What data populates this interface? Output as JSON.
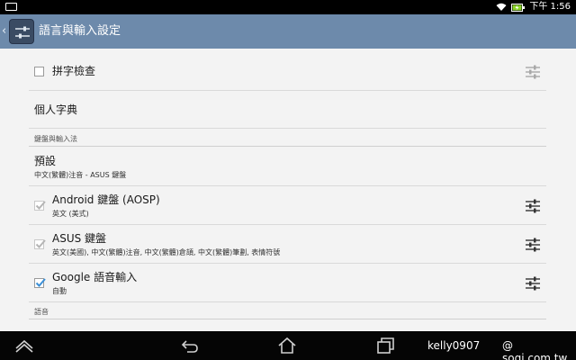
{
  "status_bar": {
    "time": "下午 1:56"
  },
  "action_bar": {
    "title": "語言與輸入設定"
  },
  "items": [
    {
      "title": "拼字檢查",
      "checked": false,
      "has_settings": true
    },
    {
      "title": "個人字典"
    },
    {
      "section": "鍵盤與輸入法"
    },
    {
      "title": "預設",
      "summary": "中文(繁體)注音 - ASUS 鍵盤"
    },
    {
      "title": "Android 鍵盤 (AOSP)",
      "summary": "英文 (美式)",
      "checked": true,
      "disabled": true,
      "has_settings": true
    },
    {
      "title": "ASUS 鍵盤",
      "summary": "英文(美國), 中文(繁體)注音, 中文(繁體)倉頡, 中文(繁體)筆劃, 表情符號",
      "checked": true,
      "disabled": true,
      "has_settings": true
    },
    {
      "title": "Google 語音輸入",
      "summary": "自動",
      "checked": true,
      "disabled": false,
      "has_settings": true
    },
    {
      "section": "語音"
    }
  ],
  "watermark": {
    "user": "kelly0907",
    "site": "@ sogi.com.tw"
  },
  "colors": {
    "action_bar": "#6d8aab",
    "check_active": "#3b8fd6",
    "check_disabled": "#b5b5b5"
  }
}
